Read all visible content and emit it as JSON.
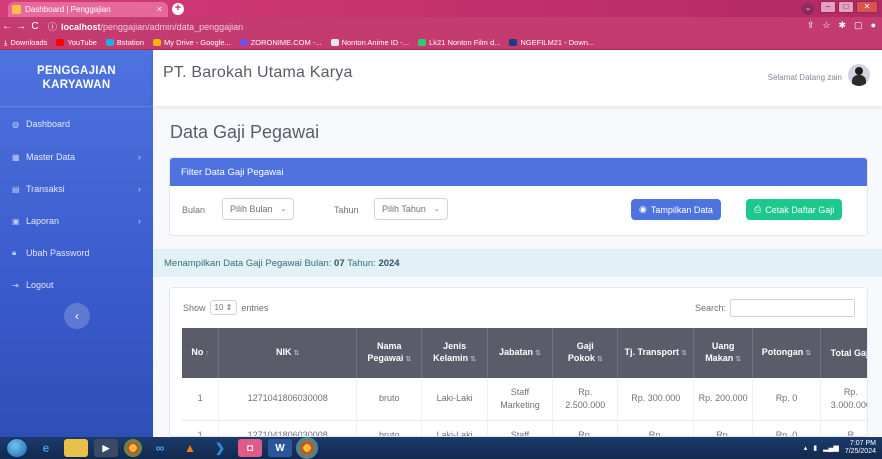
{
  "browser": {
    "tab_title": "Dashboard | Penggajian",
    "tab_close": "×",
    "new_tab": "+",
    "url_host": "localhost",
    "url_path": "/penggajian/admin/data_penggajian",
    "bookmarks": [
      {
        "label": "Downloads",
        "color": "#ffffff"
      },
      {
        "label": "YouTube",
        "color": "#ff0000"
      },
      {
        "label": "Bstation",
        "color": "#23ade5"
      },
      {
        "label": "My Drive - Google...",
        "color": "#f4b400"
      },
      {
        "label": "ZORONIME.COM -...",
        "color": "#7b4de0"
      },
      {
        "label": "Nonton Anime ID -...",
        "color": "#e8e8e8"
      },
      {
        "label": "Lk21 Nonton Film d...",
        "color": "#2ecc71"
      },
      {
        "label": "NGEFILM21 - Down...",
        "color": "#1a3a8a"
      }
    ]
  },
  "sidebar": {
    "brand_line1": "PENGGAJIAN",
    "brand_line2": "KARYAWAN",
    "items": [
      {
        "label": "Dashboard",
        "icon": "dashboard-icon",
        "has_chevron": false
      },
      {
        "label": "Master Data",
        "icon": "database-icon",
        "has_chevron": true
      },
      {
        "label": "Transaksi",
        "icon": "transaction-icon",
        "has_chevron": true
      },
      {
        "label": "Laporan",
        "icon": "report-icon",
        "has_chevron": true
      },
      {
        "label": "Ubah Password",
        "icon": "lock-icon",
        "has_chevron": false
      },
      {
        "label": "Logout",
        "icon": "logout-icon",
        "has_chevron": false
      }
    ]
  },
  "topbar": {
    "company": "PT. Barokah Utama Karya",
    "welcome": "Selamat Datang zain"
  },
  "main": {
    "title": "Data Gaji Pegawai",
    "filter": {
      "header": "Filter Data Gaji Pegawai",
      "bulan_label": "Bulan",
      "bulan_value": "Pilih Bulan",
      "tahun_label": "Tahun",
      "tahun_value": "Pilih Tahun",
      "show_button": "Tampilkan Data",
      "print_button": "Cetak Daftar Gaji"
    },
    "info_prefix": "Menampilkan Data Gaji Pegawai Bulan:",
    "info_month": "07",
    "info_year_label": "Tahun:",
    "info_year": "2024",
    "table": {
      "show_label": "Show",
      "show_value": "10",
      "entries_label": "entries",
      "search_label": "Search:",
      "columns": [
        "No",
        "NIK",
        "Nama Pegawai",
        "Jenis Kelamin",
        "Jabatan",
        "Gaji Pokok",
        "Tj. Transport",
        "Uang Makan",
        "Potongan",
        "Total Gaji"
      ],
      "rows": [
        [
          "1",
          "1271041806030008",
          "bruto",
          "Laki-Laki",
          "Staff Marketing",
          "Rp. 2.500.000",
          "Rp. 300.000",
          "Rp. 200.000",
          "Rp. 0",
          "Rp. 3.000.000"
        ],
        [
          "1",
          "1271041806030008",
          "bruto",
          "Laki-Laki",
          "Staff",
          "Rp.",
          "Rp.",
          "Rp.",
          "Rp. 0",
          "R"
        ]
      ]
    }
  },
  "taskbar": {
    "time": "7:07 PM",
    "date": "7/25/2024"
  }
}
